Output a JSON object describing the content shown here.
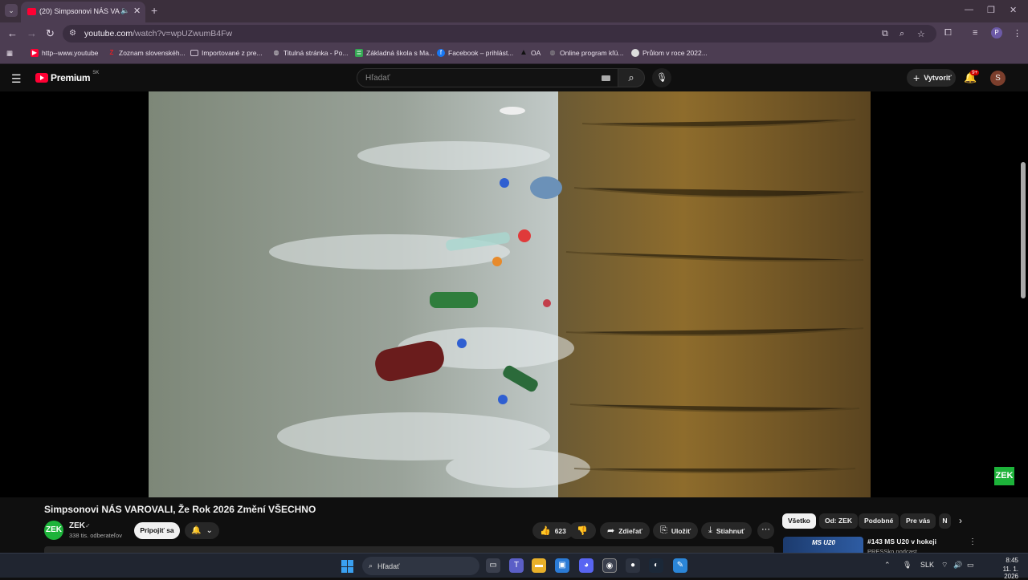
{
  "browser": {
    "tab_title": "(20) Simpsonovi NÁS VARO",
    "url_host": "youtube.com",
    "url_rest": "/watch?v=wpUZwumB4Fw",
    "profile_letter": "P",
    "bookmarks": [
      {
        "label": "http--www.youtube",
        "icon": "youtube-icon",
        "color": "#ff0033"
      },
      {
        "label": "Zoznam slovenskéh...",
        "icon": "z-icon",
        "color": "#e01f26"
      },
      {
        "label": "Importované z pre...",
        "icon": "folder-icon",
        "color": "#cbbfcf"
      },
      {
        "label": "Titulná stránka - Po...",
        "icon": "globe-icon",
        "color": "#d8d8d8"
      },
      {
        "label": "Základná škola s Ma...",
        "icon": "sheet-icon",
        "color": "#34a853"
      },
      {
        "label": "Facebook – prihlást...",
        "icon": "facebook-icon",
        "color": "#1877f2"
      },
      {
        "label": "OA",
        "icon": "oa-icon",
        "color": "#222222"
      },
      {
        "label": "Online program kľú...",
        "icon": "globe-icon",
        "color": "#999999"
      },
      {
        "label": "Průlom v roce 2022...",
        "icon": "circle-icon",
        "color": "#dddddd"
      }
    ]
  },
  "youtube": {
    "logo": "Premium",
    "country": "SK",
    "search_placeholder": "Hľadať",
    "create_label": "Vytvoriť",
    "notification_badge": "9+",
    "avatar_letter": "S",
    "watermark": "ZEK"
  },
  "video": {
    "title": "Simpsonovi NÁS VAROVALI, Že Rok 2026 Změní VŠECHNO",
    "channel": "ZEK",
    "channel_avatar": "ZEK",
    "subscribers": "338 tis. odberateľov",
    "subscribe_label": "Pripojiť sa",
    "likes": "623",
    "share_label": "Zdieľať",
    "save_label": "Uložiť",
    "download_label": "Stiahnuť"
  },
  "chips": [
    "Všetko",
    "Od: ZEK",
    "Podobné",
    "Pre vás",
    "N"
  ],
  "recommendation": {
    "thumb_text": "MS U20",
    "title": "#143 MS U20 v hokeji",
    "channel": "PRESSko podcast"
  },
  "taskbar": {
    "search_placeholder": "Hľadať",
    "language": "SLK",
    "time": "8:45",
    "date": "11. 1. 2026"
  }
}
